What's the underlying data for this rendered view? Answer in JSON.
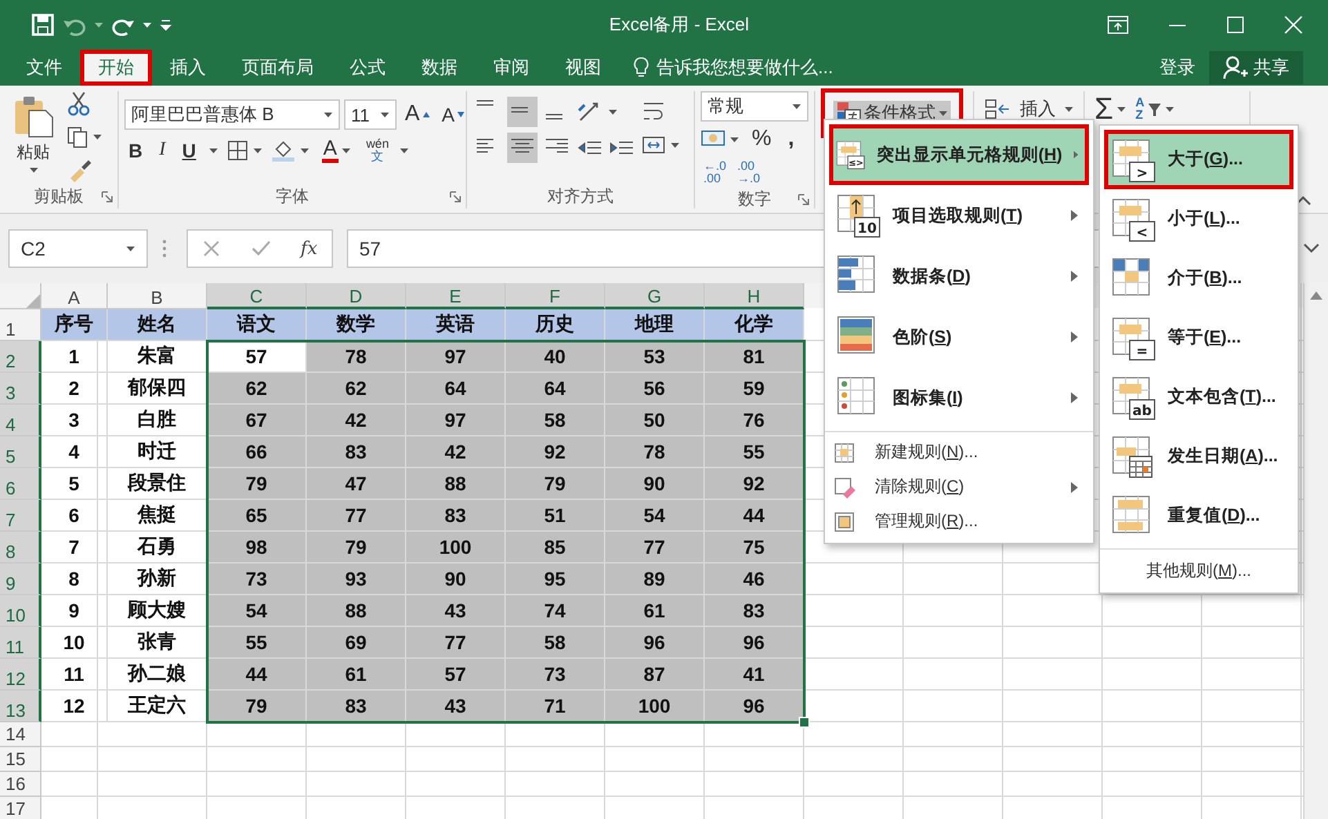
{
  "window": {
    "title": "Excel备用 - Excel"
  },
  "tabs": [
    {
      "label": "文件",
      "selected": false,
      "annotated": false
    },
    {
      "label": "开始",
      "selected": true,
      "annotated": true
    },
    {
      "label": "插入",
      "selected": false,
      "annotated": false
    },
    {
      "label": "页面布局",
      "selected": false,
      "annotated": false
    },
    {
      "label": "公式",
      "selected": false,
      "annotated": false
    },
    {
      "label": "数据",
      "selected": false,
      "annotated": false
    },
    {
      "label": "审阅",
      "selected": false,
      "annotated": false
    },
    {
      "label": "视图",
      "selected": false,
      "annotated": false
    }
  ],
  "tell_me": {
    "text": "告诉我您想要做什么..."
  },
  "account": {
    "sign_in": "登录",
    "share": "共享"
  },
  "ribbon": {
    "clipboard": {
      "paste": "粘贴",
      "title": "剪贴板"
    },
    "font": {
      "family": "阿里巴巴普惠体 B",
      "size": "11",
      "grow": "A",
      "shrink": "A",
      "bold": "B",
      "italic": "I",
      "underline": "U",
      "color_letter": "A",
      "phonetic": "wén",
      "phonetic_char": "文",
      "title": "字体"
    },
    "alignment": {
      "vertical": [
        {
          "selected": false
        },
        {
          "selected": true
        },
        {
          "selected": false
        }
      ],
      "horizontal": [
        {
          "selected": false
        },
        {
          "selected": true
        },
        {
          "selected": false
        }
      ],
      "title": "对齐方式"
    },
    "number": {
      "format": "常规",
      "percent": "%",
      "comma": ",",
      "decimals": [
        {
          "top": "←.0",
          "bottom": ".00"
        },
        {
          "top": ".00",
          "bottom": "→.0"
        }
      ],
      "title": "数字"
    },
    "styles": {
      "conditional_formatting": "条件格式",
      "annotated": true,
      "open": true
    },
    "cells": {
      "insert": "插入"
    },
    "editing": {
      "sum": "Σ",
      "sort": {
        "top": "A",
        "bottom": "Z"
      }
    }
  },
  "formula_bar": {
    "name_box": "C2",
    "function_label": "fx",
    "value": "57"
  },
  "sheet": {
    "columns": [
      {
        "label": "A",
        "selected": false
      },
      {
        "label": "B",
        "selected": false
      },
      {
        "label": "C",
        "selected": true
      },
      {
        "label": "D",
        "selected": true
      },
      {
        "label": "E",
        "selected": true
      },
      {
        "label": "F",
        "selected": true
      },
      {
        "label": "G",
        "selected": true
      },
      {
        "label": "H",
        "selected": true
      }
    ],
    "rows": [
      {
        "header": "1",
        "kind": "header",
        "selected": false,
        "cells": [
          "序号",
          "姓名",
          "语文",
          "数学",
          "英语",
          "历史",
          "地理",
          "化学"
        ]
      },
      {
        "header": "2",
        "kind": "data",
        "selected": true,
        "cells": [
          {
            "text": "1",
            "shaded": false
          },
          {
            "text": "朱富",
            "shaded": false
          },
          {
            "text": "57",
            "shaded": false
          },
          {
            "text": "78",
            "shaded": true
          },
          {
            "text": "97",
            "shaded": true
          },
          {
            "text": "40",
            "shaded": true
          },
          {
            "text": "53",
            "shaded": true
          },
          {
            "text": "81",
            "shaded": true
          }
        ]
      },
      {
        "header": "3",
        "kind": "data",
        "selected": true,
        "cells": [
          {
            "text": "2",
            "shaded": false
          },
          {
            "text": "郁保四",
            "shaded": false
          },
          {
            "text": "62",
            "shaded": true
          },
          {
            "text": "62",
            "shaded": true
          },
          {
            "text": "64",
            "shaded": true
          },
          {
            "text": "64",
            "shaded": true
          },
          {
            "text": "56",
            "shaded": true
          },
          {
            "text": "59",
            "shaded": true
          }
        ]
      },
      {
        "header": "4",
        "kind": "data",
        "selected": true,
        "cells": [
          {
            "text": "3",
            "shaded": false
          },
          {
            "text": "白胜",
            "shaded": false
          },
          {
            "text": "67",
            "shaded": true
          },
          {
            "text": "42",
            "shaded": true
          },
          {
            "text": "97",
            "shaded": true
          },
          {
            "text": "58",
            "shaded": true
          },
          {
            "text": "50",
            "shaded": true
          },
          {
            "text": "76",
            "shaded": true
          }
        ]
      },
      {
        "header": "5",
        "kind": "data",
        "selected": true,
        "cells": [
          {
            "text": "4",
            "shaded": false
          },
          {
            "text": "时迁",
            "shaded": false
          },
          {
            "text": "66",
            "shaded": true
          },
          {
            "text": "83",
            "shaded": true
          },
          {
            "text": "42",
            "shaded": true
          },
          {
            "text": "92",
            "shaded": true
          },
          {
            "text": "78",
            "shaded": true
          },
          {
            "text": "55",
            "shaded": true
          }
        ]
      },
      {
        "header": "6",
        "kind": "data",
        "selected": true,
        "cells": [
          {
            "text": "5",
            "shaded": false
          },
          {
            "text": "段景住",
            "shaded": false
          },
          {
            "text": "79",
            "shaded": true
          },
          {
            "text": "47",
            "shaded": true
          },
          {
            "text": "88",
            "shaded": true
          },
          {
            "text": "79",
            "shaded": true
          },
          {
            "text": "90",
            "shaded": true
          },
          {
            "text": "92",
            "shaded": true
          }
        ]
      },
      {
        "header": "7",
        "kind": "data",
        "selected": true,
        "cells": [
          {
            "text": "6",
            "shaded": false
          },
          {
            "text": "焦挺",
            "shaded": false
          },
          {
            "text": "65",
            "shaded": true
          },
          {
            "text": "77",
            "shaded": true
          },
          {
            "text": "83",
            "shaded": true
          },
          {
            "text": "51",
            "shaded": true
          },
          {
            "text": "54",
            "shaded": true
          },
          {
            "text": "44",
            "shaded": true
          }
        ]
      },
      {
        "header": "8",
        "kind": "data",
        "selected": true,
        "cells": [
          {
            "text": "7",
            "shaded": false
          },
          {
            "text": "石勇",
            "shaded": false
          },
          {
            "text": "98",
            "shaded": true
          },
          {
            "text": "79",
            "shaded": true
          },
          {
            "text": "100",
            "shaded": true
          },
          {
            "text": "85",
            "shaded": true
          },
          {
            "text": "77",
            "shaded": true
          },
          {
            "text": "75",
            "shaded": true
          }
        ]
      },
      {
        "header": "9",
        "kind": "data",
        "selected": true,
        "cells": [
          {
            "text": "8",
            "shaded": false
          },
          {
            "text": "孙新",
            "shaded": false
          },
          {
            "text": "73",
            "shaded": true
          },
          {
            "text": "93",
            "shaded": true
          },
          {
            "text": "90",
            "shaded": true
          },
          {
            "text": "95",
            "shaded": true
          },
          {
            "text": "89",
            "shaded": true
          },
          {
            "text": "46",
            "shaded": true
          }
        ]
      },
      {
        "header": "10",
        "kind": "data",
        "selected": true,
        "cells": [
          {
            "text": "9",
            "shaded": false
          },
          {
            "text": "顾大嫂",
            "shaded": false
          },
          {
            "text": "54",
            "shaded": true
          },
          {
            "text": "88",
            "shaded": true
          },
          {
            "text": "43",
            "shaded": true
          },
          {
            "text": "74",
            "shaded": true
          },
          {
            "text": "61",
            "shaded": true
          },
          {
            "text": "83",
            "shaded": true
          }
        ]
      },
      {
        "header": "11",
        "kind": "data",
        "selected": true,
        "cells": [
          {
            "text": "10",
            "shaded": false
          },
          {
            "text": "张青",
            "shaded": false
          },
          {
            "text": "55",
            "shaded": true
          },
          {
            "text": "69",
            "shaded": true
          },
          {
            "text": "77",
            "shaded": true
          },
          {
            "text": "58",
            "shaded": true
          },
          {
            "text": "96",
            "shaded": true
          },
          {
            "text": "96",
            "shaded": true
          }
        ]
      },
      {
        "header": "12",
        "kind": "data",
        "selected": true,
        "cells": [
          {
            "text": "11",
            "shaded": false
          },
          {
            "text": "孙二娘",
            "shaded": false
          },
          {
            "text": "44",
            "shaded": true
          },
          {
            "text": "61",
            "shaded": true
          },
          {
            "text": "57",
            "shaded": true
          },
          {
            "text": "73",
            "shaded": true
          },
          {
            "text": "87",
            "shaded": true
          },
          {
            "text": "41",
            "shaded": true
          }
        ]
      },
      {
        "header": "13",
        "kind": "data",
        "selected": true,
        "cells": [
          {
            "text": "12",
            "shaded": false
          },
          {
            "text": "王定六",
            "shaded": false
          },
          {
            "text": "79",
            "shaded": true
          },
          {
            "text": "83",
            "shaded": true
          },
          {
            "text": "43",
            "shaded": true
          },
          {
            "text": "71",
            "shaded": true
          },
          {
            "text": "100",
            "shaded": true
          },
          {
            "text": "96",
            "shaded": true
          }
        ]
      },
      {
        "header": "14",
        "kind": "empty",
        "selected": false
      },
      {
        "header": "15",
        "kind": "empty",
        "selected": false
      },
      {
        "header": "16",
        "kind": "empty",
        "selected": false
      },
      {
        "header": "17",
        "kind": "empty",
        "selected": false
      }
    ]
  },
  "conditional_menu": {
    "items": [
      {
        "kind": "large",
        "label": "突出显示单元格规则(H)",
        "icon_text": "≤>",
        "submenu": true,
        "selected": true,
        "annotated": true
      },
      {
        "kind": "large",
        "label": "项目选取规则(T)",
        "icon_text": "10",
        "submenu": true,
        "selected": false,
        "annotated": false
      },
      {
        "kind": "large",
        "label": "数据条(D)",
        "submenu": true,
        "selected": false,
        "annotated": false
      },
      {
        "kind": "large",
        "label": "色阶(S)",
        "submenu": true,
        "selected": false,
        "annotated": false
      },
      {
        "kind": "large",
        "label": "图标集(I)",
        "submenu": true,
        "selected": false,
        "annotated": false
      },
      {
        "kind": "small",
        "label": "新建规则(N)...",
        "submenu": false,
        "selected": false,
        "annotated": false
      },
      {
        "kind": "small",
        "label": "清除规则(C)",
        "submenu": true,
        "selected": false,
        "annotated": false
      },
      {
        "kind": "small",
        "label": "管理规则(R)...",
        "submenu": false,
        "selected": false,
        "annotated": false
      }
    ]
  },
  "submenu": {
    "items": [
      {
        "label": "大于(G)...",
        "icon_text": ">",
        "selected": true,
        "annotated": true
      },
      {
        "label": "小于(L)...",
        "icon_text": "<",
        "selected": false,
        "annotated": false
      },
      {
        "label": "介于(B)...",
        "selected": false,
        "annotated": false
      },
      {
        "label": "等于(E)...",
        "icon_text": "=",
        "selected": false,
        "annotated": false
      },
      {
        "label": "文本包含(T)...",
        "icon_text": "ab",
        "selected": false,
        "annotated": false
      },
      {
        "label": "发生日期(A)...",
        "selected": false,
        "annotated": false
      },
      {
        "label": "重复值(D)...",
        "selected": false,
        "annotated": false
      }
    ],
    "footer": "其他规则(M)..."
  }
}
